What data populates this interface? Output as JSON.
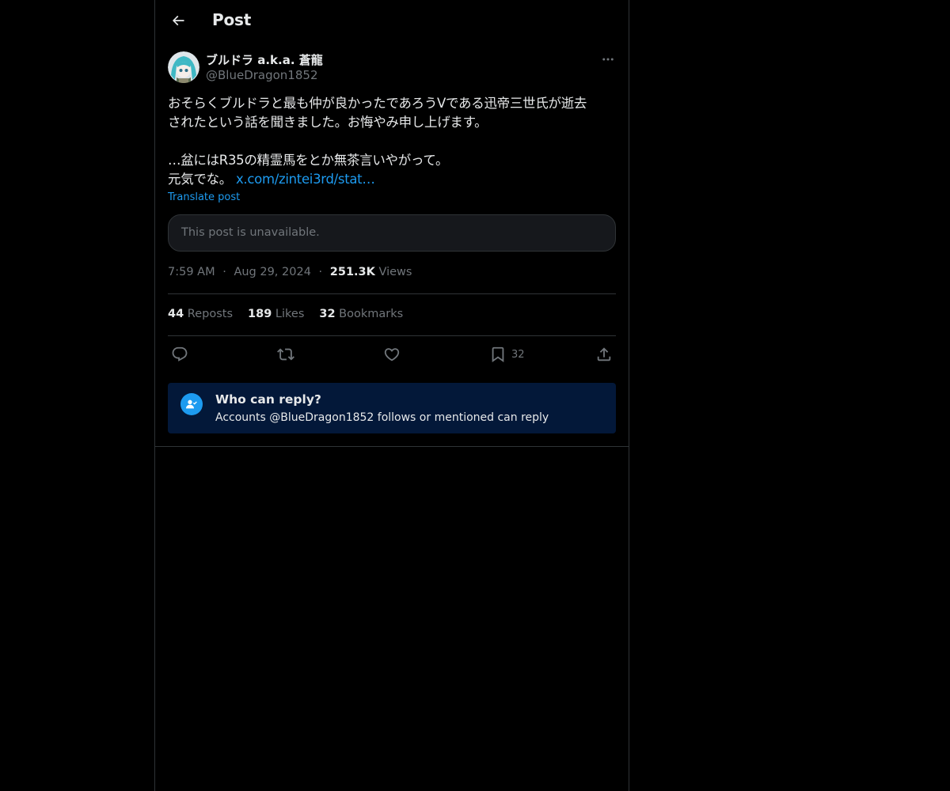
{
  "header": {
    "title": "Post",
    "back_icon": "arrow-left-icon"
  },
  "author": {
    "name": "ブルドラ a.k.a. 蒼龍",
    "handle": "@BlueDragon1852"
  },
  "post": {
    "line1": "おそらくブルドラと最も仲が良かったであろうVである迅帝三世氏が逝去",
    "line2": "されたという話を聞きました。お悔やみ申し上げます。",
    "line3": "…盆にはR35の精霊馬をとか無茶言いやがって。",
    "line4": "元気でな。",
    "link": "x.com/zintei3rd/stat…",
    "translate_label": "Translate post",
    "quote_unavailable": "This post is unavailable."
  },
  "meta": {
    "time": "7:59 AM",
    "date": "Aug 29, 2024",
    "views_count": "251.3K",
    "views_label": "Views",
    "sep": "·"
  },
  "stats": {
    "reposts_count": "44",
    "reposts_label": "Reposts",
    "likes_count": "189",
    "likes_label": "Likes",
    "bookmarks_count": "32",
    "bookmarks_label": "Bookmarks"
  },
  "actions": {
    "reply_icon": "reply-bubble-icon",
    "repost_icon": "repost-icon",
    "like_icon": "heart-icon",
    "bookmark_icon": "bookmark-icon",
    "bookmark_count": "32",
    "share_icon": "share-icon"
  },
  "reply_restriction": {
    "title": "Who can reply?",
    "subtitle": "Accounts @BlueDragon1852 follows or mentioned can reply"
  },
  "colors": {
    "background": "#000000",
    "text": "#e7e9ea",
    "muted": "#71767b",
    "accent": "#1d9bf0",
    "border": "#2f3336",
    "reply_card": "#031839"
  }
}
